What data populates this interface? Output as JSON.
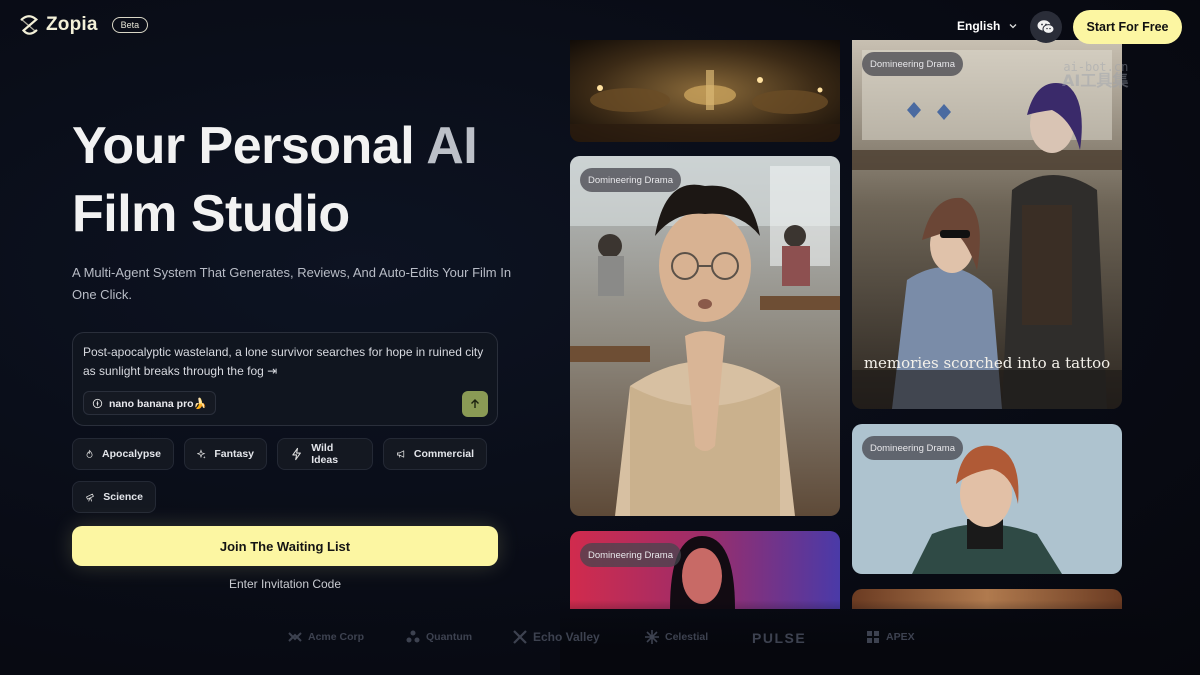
{
  "header": {
    "brand_name": "Zopia",
    "beta_label": "Beta",
    "language": "English",
    "cta_label": "Start For Free"
  },
  "hero": {
    "title_line1_part1": "Your Personal ",
    "title_line1_part2": "AI",
    "title_line2": "Film Studio",
    "subtitle": "A Multi-Agent System That Generates, Reviews, And Auto-Edits Your Film In One Click."
  },
  "prompt": {
    "text": "Post-apocalyptic wasteland, a lone survivor searches for hope in ruined city as sunlight breaks through the fog ⇥",
    "model_label": "nano banana pro🍌"
  },
  "tags": [
    {
      "label": "Apocalypse",
      "icon": "fire-icon"
    },
    {
      "label": "Fantasy",
      "icon": "sparkle-icon"
    },
    {
      "label": "Wild Ideas",
      "icon": "bolt-icon"
    },
    {
      "label": "Commercial",
      "icon": "megaphone-icon"
    },
    {
      "label": "Science",
      "icon": "telescope-icon"
    }
  ],
  "actions": {
    "join_label": "Join The Waiting List",
    "invite_label": "Enter Invitation Code"
  },
  "gallery": {
    "badge": "Domineering Drama",
    "caption_tattoo": "memories scorched into a tattoo"
  },
  "brands": [
    "Acme Corp",
    "Quantum",
    "Echo Valley",
    "Celestial",
    "PULSE",
    "APEX"
  ],
  "watermark": {
    "line1": "ai-bot.cn",
    "line2": "AI工具集"
  },
  "colors": {
    "accent": "#fcf6a2",
    "send": "#8a9a55",
    "background": "#090c16"
  }
}
